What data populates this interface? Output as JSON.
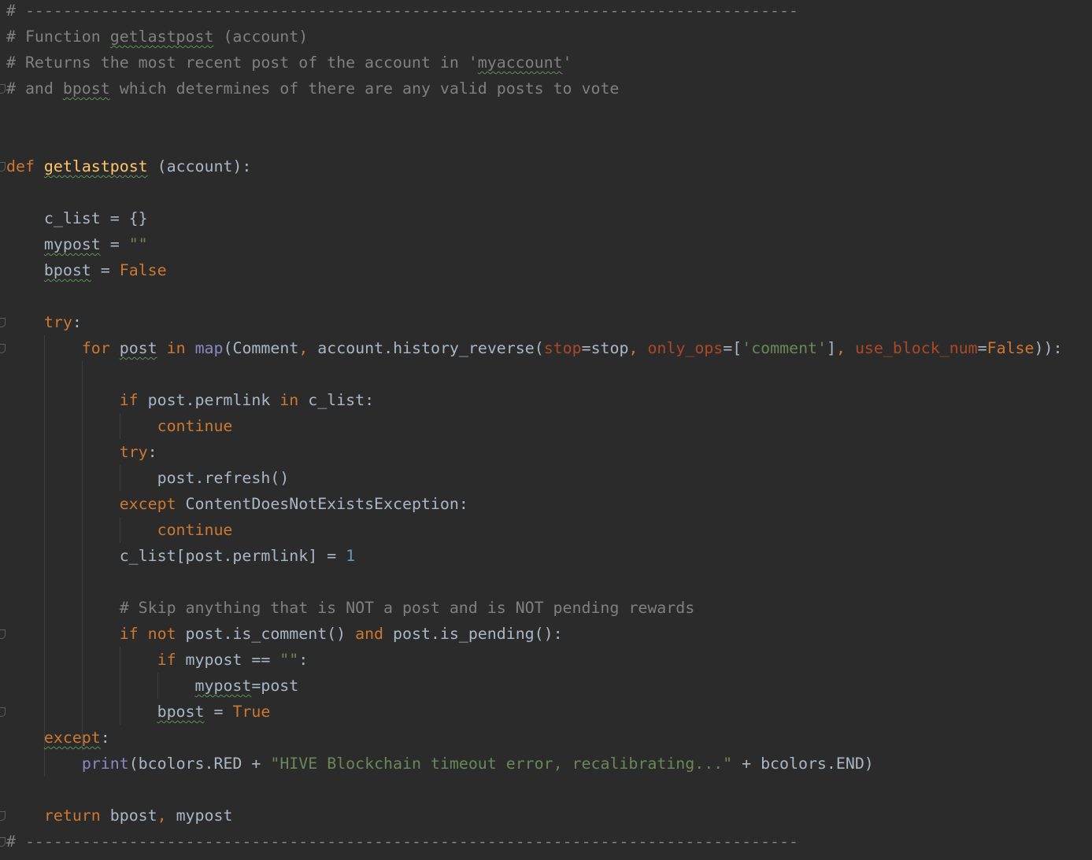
{
  "editor": {
    "theme": "darcula",
    "colors": {
      "background": "#2b2b2b",
      "text": "#a9b7c6",
      "comment": "#808080",
      "keyword": "#cc7832",
      "string": "#6a8759",
      "number": "#6897bb",
      "function_name": "#ffc66d",
      "builtin": "#8888c6",
      "keyword_argument": "#aa4926"
    },
    "lines": [
      [
        {
          "t": "# ----------------------------------------------------------------------------------",
          "c": "comment"
        }
      ],
      [
        {
          "t": "# Function ",
          "c": "comment"
        },
        {
          "t": "getlastpost",
          "c": "comment",
          "sq": true
        },
        {
          "t": " (account)",
          "c": "comment"
        }
      ],
      [
        {
          "t": "# Returns the most recent post of the account in '",
          "c": "comment"
        },
        {
          "t": "myaccount",
          "c": "comment",
          "sq": true
        },
        {
          "t": "'",
          "c": "comment"
        }
      ],
      [
        {
          "t": "# and ",
          "c": "comment"
        },
        {
          "t": "bpost",
          "c": "comment",
          "sq": true
        },
        {
          "t": " which determines of there are any valid posts to vote",
          "c": "comment"
        }
      ],
      [],
      [],
      [
        {
          "t": "def",
          "c": "kw"
        },
        {
          "t": " "
        },
        {
          "t": "getlastpost",
          "c": "fn",
          "sq": true
        },
        {
          "t": " (account):"
        }
      ],
      [],
      [
        {
          "t": "    c_list = {}"
        }
      ],
      [
        {
          "t": "    "
        },
        {
          "t": "mypost",
          "sq": true
        },
        {
          "t": " = "
        },
        {
          "t": "\"\"",
          "c": "str"
        }
      ],
      [
        {
          "t": "    "
        },
        {
          "t": "bpost",
          "sq": true
        },
        {
          "t": " = "
        },
        {
          "t": "False",
          "c": "kw"
        }
      ],
      [],
      [
        {
          "t": "    "
        },
        {
          "t": "try",
          "c": "kw"
        },
        {
          "t": ":"
        }
      ],
      [
        {
          "t": "        "
        },
        {
          "t": "for",
          "c": "kw"
        },
        {
          "t": " "
        },
        {
          "t": "post",
          "sq": true
        },
        {
          "t": " "
        },
        {
          "t": "in",
          "c": "kw"
        },
        {
          "t": " "
        },
        {
          "t": "map",
          "c": "builtin"
        },
        {
          "t": "(Comment"
        },
        {
          "t": ",",
          "c": "kw"
        },
        {
          "t": " account.history_reverse("
        },
        {
          "t": "stop",
          "c": "kwarg"
        },
        {
          "t": "=stop"
        },
        {
          "t": ",",
          "c": "kw"
        },
        {
          "t": " "
        },
        {
          "t": "only_ops",
          "c": "kwarg"
        },
        {
          "t": "=["
        },
        {
          "t": "'comment'",
          "c": "str"
        },
        {
          "t": "]"
        },
        {
          "t": ",",
          "c": "kw"
        },
        {
          "t": " "
        },
        {
          "t": "use_block_num",
          "c": "kwarg"
        },
        {
          "t": "="
        },
        {
          "t": "False",
          "c": "kw"
        },
        {
          "t": ")):"
        }
      ],
      [],
      [
        {
          "t": "            "
        },
        {
          "t": "if",
          "c": "kw"
        },
        {
          "t": " post.permlink "
        },
        {
          "t": "in",
          "c": "kw"
        },
        {
          "t": " c_list:"
        }
      ],
      [
        {
          "t": "                "
        },
        {
          "t": "continue",
          "c": "kw"
        }
      ],
      [
        {
          "t": "            "
        },
        {
          "t": "try",
          "c": "kw"
        },
        {
          "t": ":"
        }
      ],
      [
        {
          "t": "                post.refresh()"
        }
      ],
      [
        {
          "t": "            "
        },
        {
          "t": "except",
          "c": "kw"
        },
        {
          "t": " ContentDoesNotExistsException:"
        }
      ],
      [
        {
          "t": "                "
        },
        {
          "t": "continue",
          "c": "kw"
        }
      ],
      [
        {
          "t": "            c_list[post.permlink] = "
        },
        {
          "t": "1",
          "c": "num"
        }
      ],
      [],
      [
        {
          "t": "            "
        },
        {
          "t": "# Skip anything that is NOT a post and is NOT pending rewards",
          "c": "comment"
        }
      ],
      [
        {
          "t": "            "
        },
        {
          "t": "if",
          "c": "kw"
        },
        {
          "t": " "
        },
        {
          "t": "not",
          "c": "kw"
        },
        {
          "t": " post.is_comment() "
        },
        {
          "t": "and",
          "c": "kw"
        },
        {
          "t": " post.is_pending():"
        }
      ],
      [
        {
          "t": "                "
        },
        {
          "t": "if",
          "c": "kw"
        },
        {
          "t": " mypost == "
        },
        {
          "t": "\"\"",
          "c": "str"
        },
        {
          "t": ":"
        }
      ],
      [
        {
          "t": "                    "
        },
        {
          "t": "mypost",
          "sq": true
        },
        {
          "t": "=post"
        }
      ],
      [
        {
          "t": "                "
        },
        {
          "t": "bpost",
          "sq": true
        },
        {
          "t": " = "
        },
        {
          "t": "True",
          "c": "kw"
        }
      ],
      [
        {
          "t": "    "
        },
        {
          "t": "except",
          "c": "kw",
          "sq": true
        },
        {
          "t": ":"
        }
      ],
      [
        {
          "t": "        "
        },
        {
          "t": "print",
          "c": "builtin"
        },
        {
          "t": "(bcolors.RED + "
        },
        {
          "t": "\"HIVE Blockchain timeout error, recalibrating...\"",
          "c": "str"
        },
        {
          "t": " + bcolors.END)"
        }
      ],
      [],
      [
        {
          "t": "    "
        },
        {
          "t": "return",
          "c": "kw"
        },
        {
          "t": " bpost"
        },
        {
          "t": ",",
          "c": "kw"
        },
        {
          "t": " mypost"
        }
      ],
      [
        {
          "t": "# ----------------------------------------------------------------------------------",
          "c": "comment"
        }
      ]
    ]
  }
}
